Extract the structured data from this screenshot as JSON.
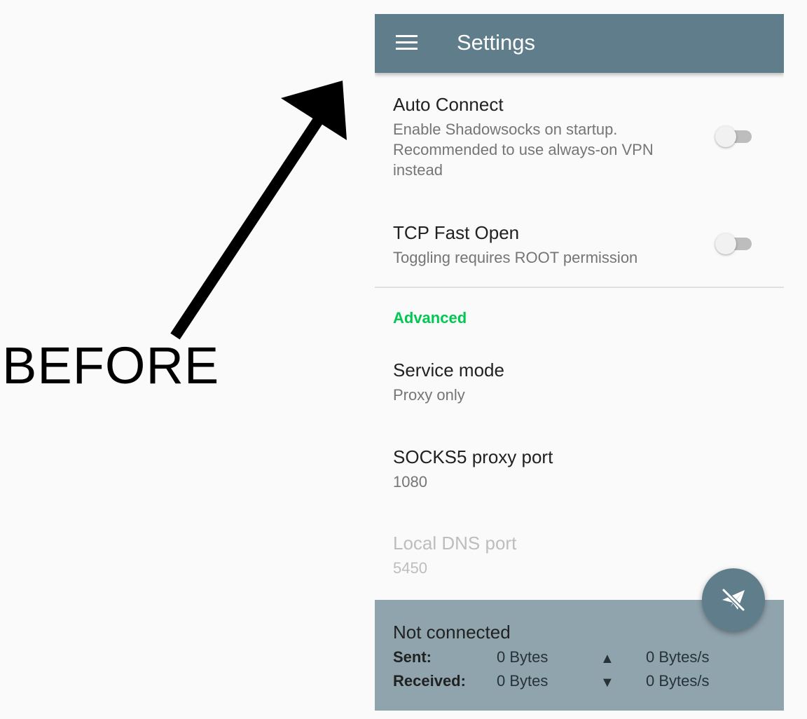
{
  "annotation": {
    "label": "BEFORE"
  },
  "toolbar": {
    "menu_icon": "menu-icon",
    "title": "Settings"
  },
  "preferences": {
    "auto_connect": {
      "title": "Auto Connect",
      "summary": "Enable Shadowsocks on startup. Recommended to use always-on VPN instead",
      "enabled": false
    },
    "tcp_fast_open": {
      "title": "TCP Fast Open",
      "summary": "Toggling requires ROOT permission",
      "enabled": false
    },
    "advanced_category": "Advanced",
    "service_mode": {
      "title": "Service mode",
      "summary": "Proxy only"
    },
    "socks5_port": {
      "title": "SOCKS5 proxy port",
      "summary": "1080"
    },
    "local_dns_port": {
      "title": "Local DNS port",
      "summary": "5450"
    }
  },
  "stats": {
    "status": "Not connected",
    "sent_label": "Sent:",
    "sent_bytes": "0 Bytes",
    "sent_rate": "0 Bytes/s",
    "received_label": "Received:",
    "received_bytes": "0 Bytes",
    "received_rate": "0 Bytes/s"
  },
  "fab": {
    "icon": "paper-plane-off-icon"
  },
  "colors": {
    "primary": "#607d8b",
    "stats_background": "#90a4ae",
    "accent": "#00c853"
  }
}
